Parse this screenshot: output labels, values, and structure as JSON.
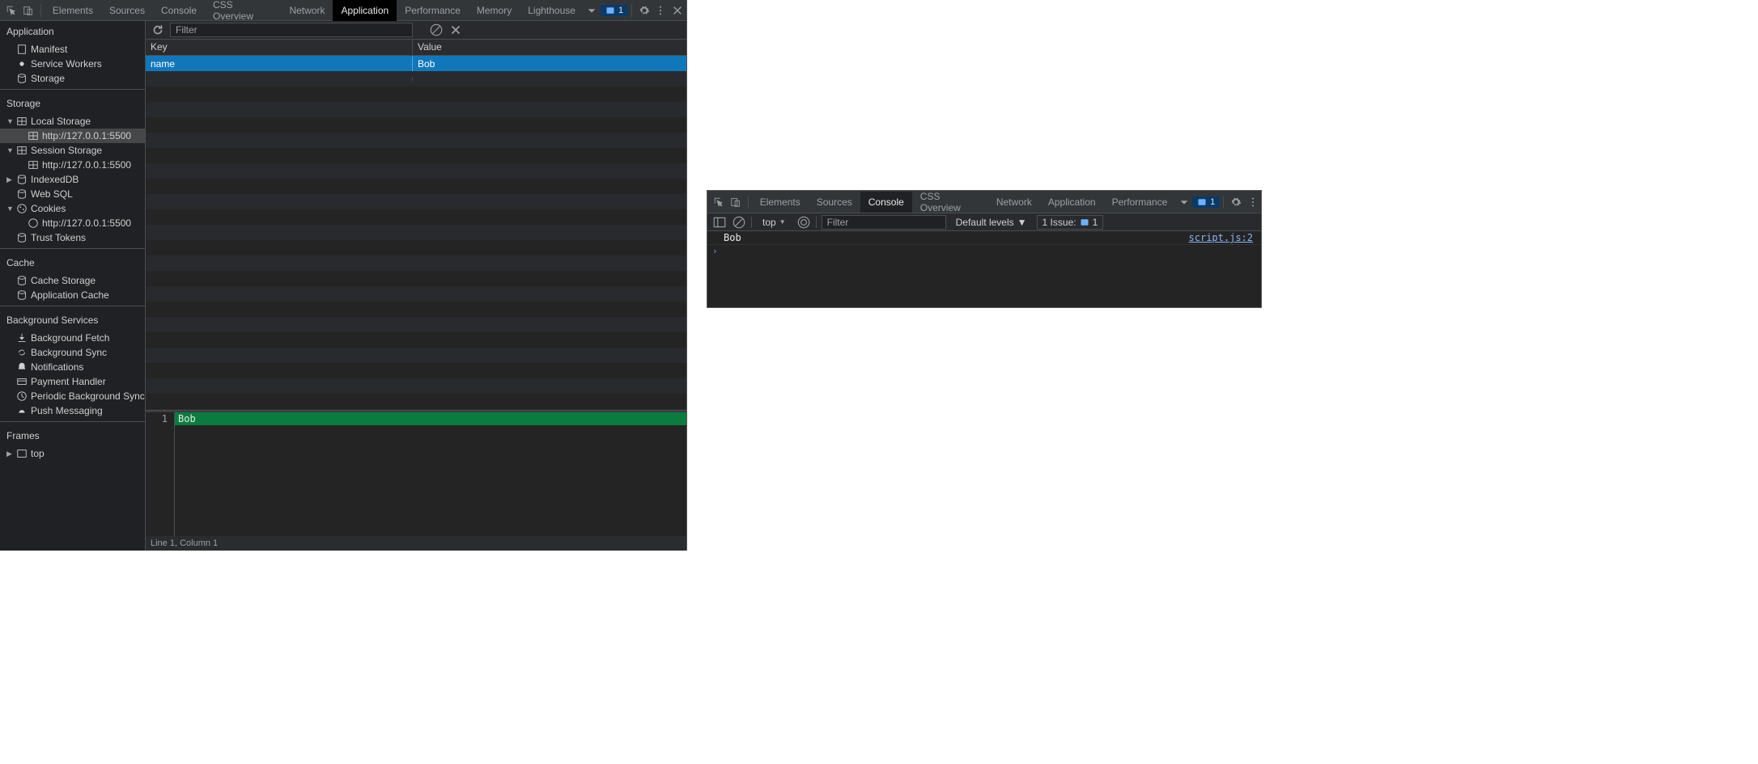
{
  "left": {
    "tabs": [
      "Elements",
      "Sources",
      "Console",
      "CSS Overview",
      "Network",
      "Application",
      "Performance",
      "Memory",
      "Lighthouse"
    ],
    "active_tab": "Application",
    "issue_count": "1",
    "sidebar": {
      "section_app": "Application",
      "app_items": {
        "manifest": "Manifest",
        "service_workers": "Service Workers",
        "storage": "Storage"
      },
      "section_storage": "Storage",
      "local_storage": "Local Storage",
      "local_storage_url": "http://127.0.0.1:5500",
      "session_storage": "Session Storage",
      "session_storage_url": "http://127.0.0.1:5500",
      "indexeddb": "IndexedDB",
      "websql": "Web SQL",
      "cookies": "Cookies",
      "cookies_url": "http://127.0.0.1:5500",
      "trust_tokens": "Trust Tokens",
      "section_cache": "Cache",
      "cache_storage": "Cache Storage",
      "app_cache": "Application Cache",
      "section_bg": "Background Services",
      "bg_fetch": "Background Fetch",
      "bg_sync": "Background Sync",
      "notifications": "Notifications",
      "payment": "Payment Handler",
      "periodic_bg_sync": "Periodic Background Sync",
      "push": "Push Messaging",
      "section_frames": "Frames",
      "top_frame": "top"
    },
    "filter_placeholder": "Filter",
    "table": {
      "col_key": "Key",
      "col_value": "Value",
      "rows": [
        {
          "key": "name",
          "value": "Bob"
        }
      ]
    },
    "editor": {
      "line_no": "1",
      "value": "Bob"
    },
    "status": "Line 1, Column 1"
  },
  "right": {
    "tabs": [
      "Elements",
      "Sources",
      "Console",
      "CSS Overview",
      "Network",
      "Application",
      "Performance"
    ],
    "active_tab": "Console",
    "issue_count": "1",
    "toolbar": {
      "context": "top",
      "filter_placeholder": "Filter",
      "levels": "Default levels",
      "issues_label": "1 Issue:",
      "issues_count": "1"
    },
    "log": {
      "msg": "Bob",
      "src": "script.js:2"
    }
  }
}
